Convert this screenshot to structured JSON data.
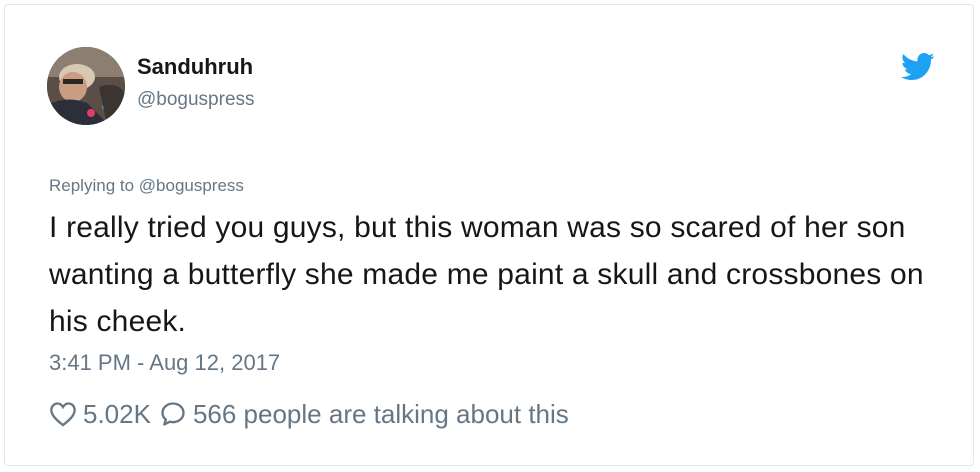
{
  "tweet": {
    "display_name": "Sanduhruh",
    "handle": "@boguspress",
    "replying_to": "Replying to @boguspress",
    "text": "I really tried you guys, but this woman was so scared of her son wanting a butterfly she made me paint a skull and crossbones on his cheek.",
    "timestamp": "3:41 PM - Aug 12, 2017"
  },
  "actions": {
    "likes_count": "5.02K",
    "talking_text": "566 people are talking about this"
  },
  "icons": {
    "brand": "twitter-bird-icon",
    "like": "heart-icon",
    "reply": "speech-bubble-icon"
  },
  "colors": {
    "brand": "#1da1f2",
    "text": "#14171a",
    "secondary": "#657786",
    "border": "#e1e8ed"
  }
}
